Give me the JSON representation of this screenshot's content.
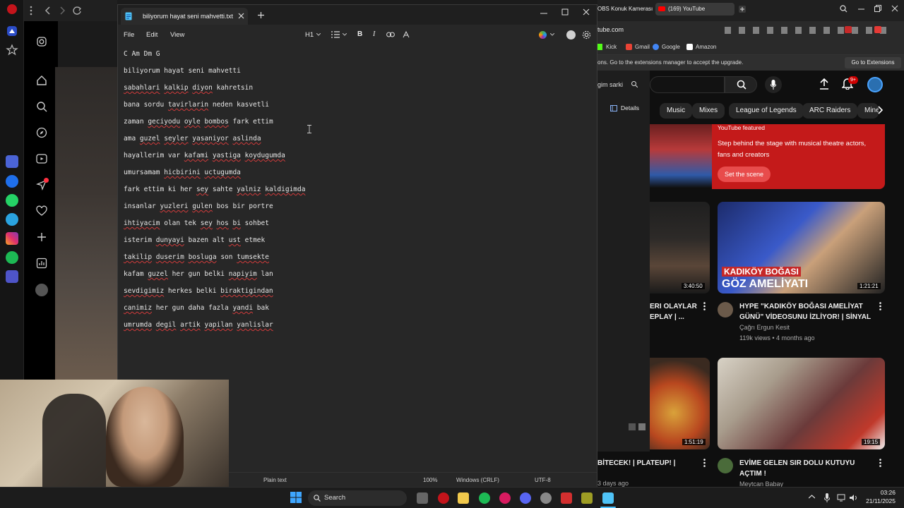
{
  "notepad": {
    "tab_title": "biliyorum hayat seni mahvetti.txt",
    "menu": [
      "File",
      "Edit",
      "View"
    ],
    "heading_style": "H1",
    "lines": [
      [
        {
          "t": "C Am Dm G"
        }
      ],
      [
        {
          "t": "biliyorum hayat seni mahvetti"
        }
      ],
      [
        {
          "t": "sabahlari",
          "s": 1
        },
        {
          "t": " "
        },
        {
          "t": "kalkip",
          "s": 1
        },
        {
          "t": " "
        },
        {
          "t": "diyon",
          "s": 1
        },
        {
          "t": " kahretsin"
        }
      ],
      [
        {
          "t": "bana sordu "
        },
        {
          "t": "tavirlarin",
          "s": 1
        },
        {
          "t": " neden kasvetli"
        }
      ],
      [
        {
          "t": "zaman "
        },
        {
          "t": "geciyodu",
          "s": 1
        },
        {
          "t": " "
        },
        {
          "t": "oyle",
          "s": 1
        },
        {
          "t": " "
        },
        {
          "t": "bombos",
          "s": 1
        },
        {
          "t": " fark ettim"
        }
      ],
      [
        {
          "t": "ama "
        },
        {
          "t": "guzel",
          "s": 1
        },
        {
          "t": " "
        },
        {
          "t": "seyler",
          "s": 1
        },
        {
          "t": " "
        },
        {
          "t": "yasaniyor",
          "s": 1
        },
        {
          "t": " "
        },
        {
          "t": "aslinda",
          "s": 1
        }
      ],
      [
        {
          "t": "hayallerim var "
        },
        {
          "t": "kafami",
          "s": 1
        },
        {
          "t": " "
        },
        {
          "t": "yastiga",
          "s": 1
        },
        {
          "t": " "
        },
        {
          "t": "koydugumda",
          "s": 1
        }
      ],
      [
        {
          "t": "umursamam "
        },
        {
          "t": "hicbirini",
          "s": 1
        },
        {
          "t": " "
        },
        {
          "t": "uctugumda",
          "s": 1
        }
      ],
      [
        {
          "t": "fark ettim ki her "
        },
        {
          "t": "sey",
          "s": 1
        },
        {
          "t": " sahte "
        },
        {
          "t": "yalniz",
          "s": 1
        },
        {
          "t": " "
        },
        {
          "t": "kaldigimda",
          "s": 1
        }
      ],
      [
        {
          "t": "insanlar "
        },
        {
          "t": "yuzleri",
          "s": 1
        },
        {
          "t": " "
        },
        {
          "t": "gulen",
          "s": 1
        },
        {
          "t": " bos bir portre"
        }
      ],
      [
        {
          "t": "ihtiyacim",
          "s": 1
        },
        {
          "t": " olan tek "
        },
        {
          "t": "sey",
          "s": 1
        },
        {
          "t": " "
        },
        {
          "t": "hos",
          "s": 1
        },
        {
          "t": " "
        },
        {
          "t": "bi",
          "s": 1
        },
        {
          "t": " sohbet"
        }
      ],
      [
        {
          "t": "isterim "
        },
        {
          "t": "dunyayi",
          "s": 1
        },
        {
          "t": " bazen alt "
        },
        {
          "t": "ust",
          "s": 1
        },
        {
          "t": " etmek"
        }
      ],
      [
        {
          "t": "takilip",
          "s": 1
        },
        {
          "t": " "
        },
        {
          "t": "duserim",
          "s": 1
        },
        {
          "t": " "
        },
        {
          "t": "bosluga",
          "s": 1
        },
        {
          "t": " son "
        },
        {
          "t": "tumsekte",
          "s": 1
        }
      ],
      [
        {
          "t": "kafam "
        },
        {
          "t": "guzel",
          "s": 1
        },
        {
          "t": " her gun belki "
        },
        {
          "t": "napiyim",
          "s": 1
        },
        {
          "t": " lan"
        }
      ],
      [
        {
          "t": "sevdigimiz",
          "s": 1
        },
        {
          "t": " herkes belki "
        },
        {
          "t": "biraktigindan",
          "s": 1
        }
      ],
      [
        {
          "t": "canimiz",
          "s": 1
        },
        {
          "t": " her gun daha fazla "
        },
        {
          "t": "yandi",
          "s": 1
        },
        {
          "t": " bak"
        }
      ],
      [
        {
          "t": "umrumda",
          "s": 1
        },
        {
          "t": " "
        },
        {
          "t": "degil",
          "s": 1
        },
        {
          "t": " "
        },
        {
          "t": "artik",
          "s": 1
        },
        {
          "t": " "
        },
        {
          "t": "yapilan",
          "s": 1
        },
        {
          "t": " "
        },
        {
          "t": "yanlislar",
          "s": 1
        }
      ]
    ],
    "status": {
      "format": "Plain text",
      "zoom": "100%",
      "line_ending": "Windows (CRLF)",
      "encoding": "UTF-8"
    }
  },
  "browser_right": {
    "tabs": [
      {
        "label": "OBS Konuk Kamerası"
      },
      {
        "label": "(169) YouTube"
      }
    ],
    "url": "tube.com",
    "bookmarks": [
      "Kick",
      "Gmail",
      "Google",
      "Amazon"
    ],
    "infobar_text": "ons. Go to the extensions manager to accept the upgrade.",
    "infobar_button": "Go to Extensions",
    "panel_search_placeholder": "gim sarki",
    "panel_details": "Details",
    "notif_count": "9+",
    "chips": [
      "Music",
      "Mixes",
      "League of Legends",
      "ARC Raiders",
      "Mine"
    ],
    "featured": {
      "badge": "YouTube featured",
      "text": "Step behind the stage with musical theatre actors, fans and creators",
      "button": "Set the scene"
    },
    "videos": [
      {
        "title": "ERI OLAYLAR EPLAY | ...",
        "duration": "3:40:50"
      },
      {
        "title": "HYPE \"KADIKÖY BOĞASI AMELİYAT GÜNÜ\" VİDEOSUNU İZLİYOR! | SİNYAL",
        "channel": "Çağrı Ergun Kesit",
        "meta": "119k views • 4 months ago",
        "duration": "1:21:21",
        "thumb_text_1": "KADIKÖY BOĞASI",
        "thumb_text_2": "GÖZ AMELİYATI"
      },
      {
        "title": "BİTECEK! | PLATEUP! |",
        "meta": "3 days ago",
        "duration": "1:51:19"
      },
      {
        "title": "EVİME GELEN SIR DOLU KUTUYU AÇTIM !",
        "channel": "Meytcan Babay",
        "duration": "19:15"
      }
    ]
  },
  "taskbar": {
    "search": "Search",
    "time": "03:26",
    "date": "21/11/2025"
  }
}
